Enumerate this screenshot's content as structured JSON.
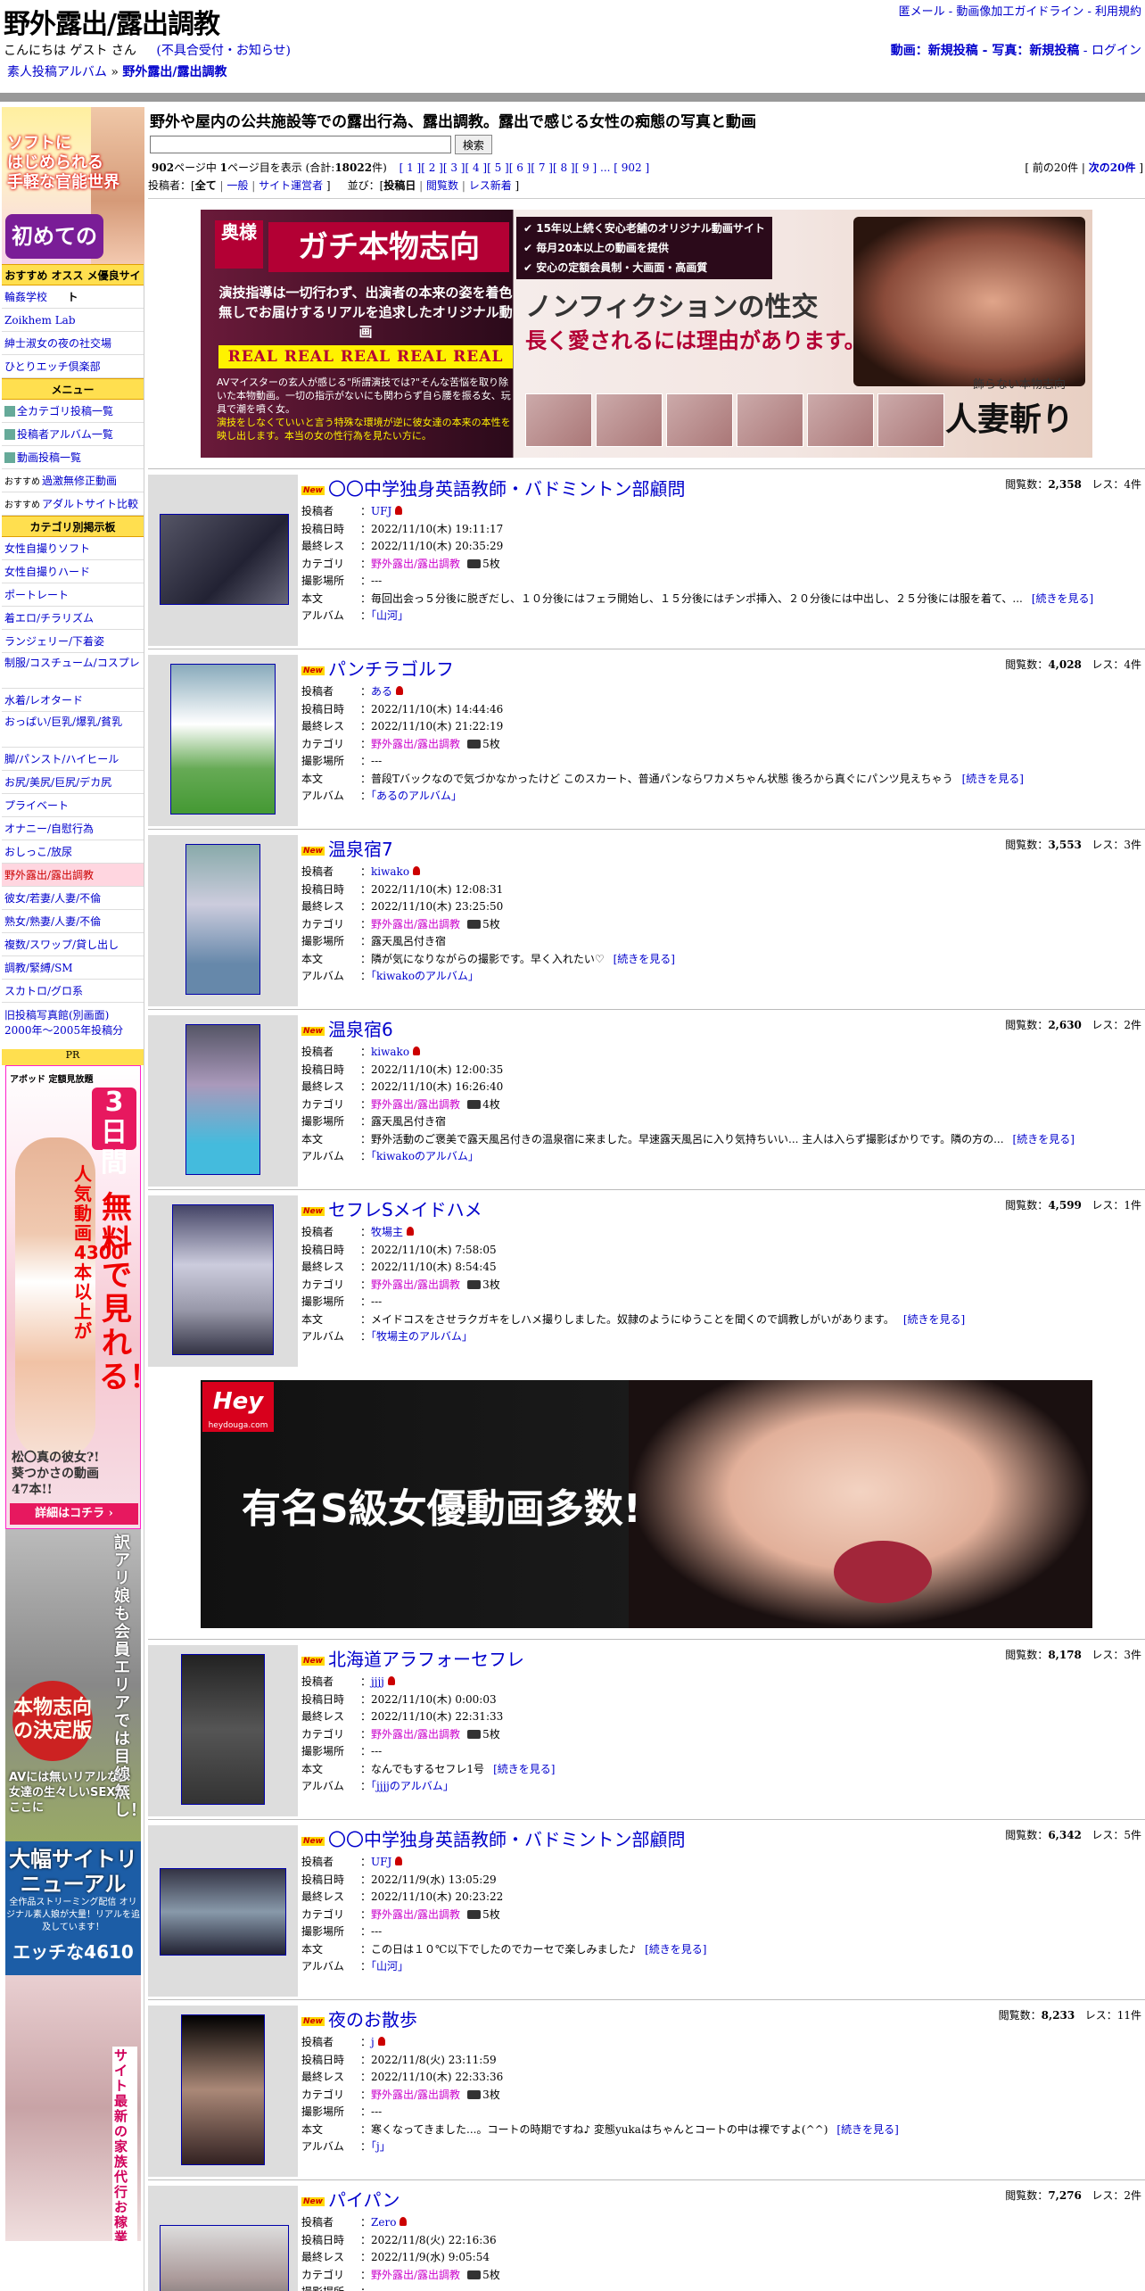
{
  "header": {
    "title": "野外露出/露出調教",
    "greeting": "こんにちは ゲスト さん",
    "greeting_link": "(不具合受付・お知らせ)",
    "crumb_root": "素人投稿アルバム",
    "crumb_arrow": " » ",
    "crumb_current": "野外露出/露出調教",
    "top_links": "匿メール - 動画像加工ガイドライン - 利用規約",
    "post_links": "動画：新規投稿 - 写真：新規投稿",
    "post_login": " - ログイン"
  },
  "sidebar": {
    "banner_line1": "ソフトに",
    "banner_line2": "はじめられる",
    "banner_line3": "手軽な官能世界",
    "banner_sm": "初めてのSM",
    "recommend_head": "おすすめ オスス メ優良サイト",
    "recommend_items": [
      "輪姦学校",
      "Zoikhem Lab",
      "紳士淑女の夜の社交場",
      "ひとりエッチ倶楽部"
    ],
    "menu_head": "メニュー",
    "menu_items": [
      "全カテゴリ投稿一覧",
      "投稿者アルバム一覧",
      "動画投稿一覧"
    ],
    "menu_rec1_badge": "おすすめ",
    "menu_rec1": "過激無修正動画",
    "menu_rec2_badge": "おすすめ",
    "menu_rec2": "アダルトサイト比較",
    "category_head": "カテゴリ別掲示板",
    "category_items": [
      "女性自撮りソフト",
      "女性自撮りハード",
      "ポートレート",
      "着エロ/チラリズム",
      "ランジェリー/下着姿",
      "制服/コスチューム/コスプレ",
      "水着/レオタード",
      "おっぱい/巨乳/爆乳/貧乳",
      "脚/パンスト/ハイヒール",
      "お尻/美尻/巨尻/デカ尻",
      "プライベート",
      "オナニー/自慰行為",
      "おしっこ/放尿",
      "野外露出/露出調教",
      "彼女/若妻/人妻/不倫",
      "熟女/熟妻/人妻/不倫",
      "複数/スワップ/貸し出し",
      "調教/緊縛/SM",
      "スカトロ/グロ系"
    ],
    "category_selected_index": 13,
    "old_link1": "旧投稿写真館(別画面)",
    "old_link2": "2000年～2005年投稿分",
    "pr_label": "PR",
    "ad1_brand": "アボッド 定額見放題",
    "ad1_days": "3日間",
    "ad1_copy": "人気動画4300本以上が",
    "ad1_free": "無料で見れる！",
    "ad1_name": "松〇真の彼女?! 葵つかさの動画47本!!",
    "ad1_more": "詳細はコチラ ›",
    "ad2_vertical": "訳アリ娘も会員エリアでは目線無し！",
    "ad2_circle": "本物志向の決定版",
    "ad2_copy": "AVには無いリアルな少女達の生々しいSEXがここに",
    "ad3_head": "大幅サイトリニューアル",
    "ad3_sub": "全作品ストリーミング配信 オリジナル素人娘が大量！リアルを追及しています！",
    "ad3_brand": "エッチな4610",
    "ad4_vertical": "サイト最新の家族代行お稼業がご奉仕しちゃう"
  },
  "main": {
    "description": "野外や屋内の公共施設等での露出行為、露出調教。露出で感じる女性の痴態の写真と動画",
    "search_button": "検索",
    "search_value": "",
    "pager_summary_pre": "902",
    "pager_summary_mid": "ページ中 ",
    "pager_page": "1",
    "pager_summary_post": "ページ目を表示 (合計:",
    "pager_total": "18022",
    "pager_summary_end": "件)",
    "pager_pages": "[ 1 ][ 2 ][ 3 ][ 4 ][ 5 ][ 6 ][ 7 ][ 8 ][ 9 ] ... [ 902 ]",
    "pager_prev": "[ 前の20件 | ",
    "pager_next": "次の20件",
    "pager_close": " ]",
    "filter_label": "投稿者：[",
    "filter_all": "全て",
    "filter_general": "一般",
    "filter_admin": "サイト運営者",
    "filter_close": " ]",
    "sort_label": "並び：[",
    "sort_date": "投稿日",
    "sort_views": "閲覧数",
    "sort_replies": "レス新着",
    "sort_close": " ]"
  },
  "banner1": {
    "brand": "奥様",
    "headline": "ガチ本物志向",
    "copy": "演技指導は一切行わず、出演者の本来の姿を着色無しでお届けするリアルを追求したオリジナル動画",
    "real": "REAL REAL REAL REAL REAL",
    "small1": "AVマイスターの玄人が感じる\"所謂演技では?\"そんな苦悩を取り除いた本物動画。一切の指示がないにも関わらず自ら腰を振る女、玩具で潮を噴く女。",
    "small2": "演技をしなくていいと言う特殊な環境が逆に彼女達の本来の本性を映し出します。本当の女の性行為を見たい方に。",
    "bullets": [
      "15年以上続く安心老舗のオリジナル動画サイト",
      "毎月20本以上の動画を提供",
      "安心の定額会員制・大画面・高画質"
    ],
    "big1": "ノンフィクションの性交",
    "big2": "長く愛されるには理由があります。",
    "logo": "人妻斬り",
    "tag": "飾らない本物志向"
  },
  "banner2": {
    "logo": "Hey",
    "logo_sub": "heydouga.com",
    "copy": "有名S級女優動画多数!"
  },
  "labels": {
    "new": "New",
    "views": "閲覧数：",
    "replies": "レス：",
    "author": "投稿者",
    "posted": "投稿日時",
    "last": "最終レス",
    "category": "カテゴリ",
    "place": "撮影場所",
    "body": "本文",
    "album": "アルバム",
    "colon": "：",
    "more": "[続きを見る]"
  },
  "posts": [
    {
      "title": "〇〇中学独身英語教師・バドミントン部顧問",
      "views": "2,358",
      "replies": "4件",
      "author": "UFJ",
      "posted": "2022/11/10(木) 19:11:17",
      "last": "2022/11/10(木) 20:35:29",
      "category": "野外露出/露出調教",
      "photos": "5枚",
      "place": "---",
      "body": "毎回出会っ５分後に脱ぎだし、１０分後にはフェラ開始し、１５分後にはチンポ挿入、２０分後には中出し、２５分後には服を着て、...",
      "album": "「山河」"
    },
    {
      "title": "パンチラゴルフ",
      "views": "4,028",
      "replies": "4件",
      "author": "ある",
      "posted": "2022/11/10(木) 14:44:46",
      "last": "2022/11/10(木) 21:22:19",
      "category": "野外露出/露出調教",
      "photos": "5枚",
      "place": "---",
      "body": "普段Tバックなので気づかなかったけど このスカート、普通パンならワカメちゃん状態 後ろから真ぐにパンツ見えちゃう",
      "album": "「あるのアルバム」"
    },
    {
      "title": "温泉宿7",
      "views": "3,553",
      "replies": "3件",
      "author": "kiwako",
      "posted": "2022/11/10(木) 12:08:31",
      "last": "2022/11/10(木) 23:25:50",
      "category": "野外露出/露出調教",
      "photos": "5枚",
      "place": "露天風呂付き宿",
      "body": "隣が気になりながらの撮影です。早く入れたい♡",
      "album": "「kiwakoのアルバム」"
    },
    {
      "title": "温泉宿6",
      "views": "2,630",
      "replies": "2件",
      "author": "kiwako",
      "posted": "2022/11/10(木) 12:00:35",
      "last": "2022/11/10(木) 16:26:40",
      "category": "野外露出/露出調教",
      "photos": "4枚",
      "place": "露天風呂付き宿",
      "body": "野外活動のご褒美で露天風呂付きの温泉宿に来ました。早速露天風呂に入り気持ちいい... 主人は入らず撮影ばかりです。隣の方の...",
      "album": "「kiwakoのアルバム」"
    },
    {
      "title": "セフレSメイドハメ",
      "views": "4,599",
      "replies": "1件",
      "author": "牧場主",
      "posted": "2022/11/10(木) 7:58:05",
      "last": "2022/11/10(木) 8:54:45",
      "category": "野外露出/露出調教",
      "photos": "3枚",
      "place": "---",
      "body": "メイドコスをさせラクガキをしハメ撮りしました。奴隷のようにゆうことを聞くので調教しがいがあります。",
      "album": "「牧場主のアルバム」"
    },
    {
      "title": "北海道アラフォーセフレ",
      "views": "8,178",
      "replies": "3件",
      "author": "jjjj",
      "posted": "2022/11/10(木) 0:00:03",
      "last": "2022/11/10(木) 22:31:33",
      "category": "野外露出/露出調教",
      "photos": "5枚",
      "place": "---",
      "body": "なんでもするセフレ1号",
      "album": "「jjjjのアルバム」"
    },
    {
      "title": "〇〇中学独身英語教師・バドミントン部顧問",
      "views": "6,342",
      "replies": "5件",
      "author": "UFJ",
      "posted": "2022/11/9(水) 13:05:29",
      "last": "2022/11/10(木) 20:23:22",
      "category": "野外露出/露出調教",
      "photos": "5枚",
      "place": "---",
      "body": "この日は１０℃以下でしたのでカーセで楽しみました♪",
      "album": "「山河」"
    },
    {
      "title": "夜のお散歩",
      "views": "8,233",
      "replies": "11件",
      "author": "j",
      "posted": "2022/11/8(火) 23:11:59",
      "last": "2022/11/10(木) 22:33:36",
      "category": "野外露出/露出調教",
      "photos": "3枚",
      "place": "---",
      "body": "寒くなってきました...。コートの時期ですね♪ 変態yukaはちゃんとコートの中は裸ですよ(^^)",
      "album": "「j」"
    },
    {
      "title": "パイパン",
      "views": "7,276",
      "replies": "2件",
      "author": "Zero",
      "posted": "2022/11/8(火) 22:16:36",
      "last": "2022/11/9(水) 9:05:54",
      "category": "野外露出/露出調教",
      "photos": "5枚",
      "place": "---",
      "body": "",
      "album": ""
    }
  ]
}
